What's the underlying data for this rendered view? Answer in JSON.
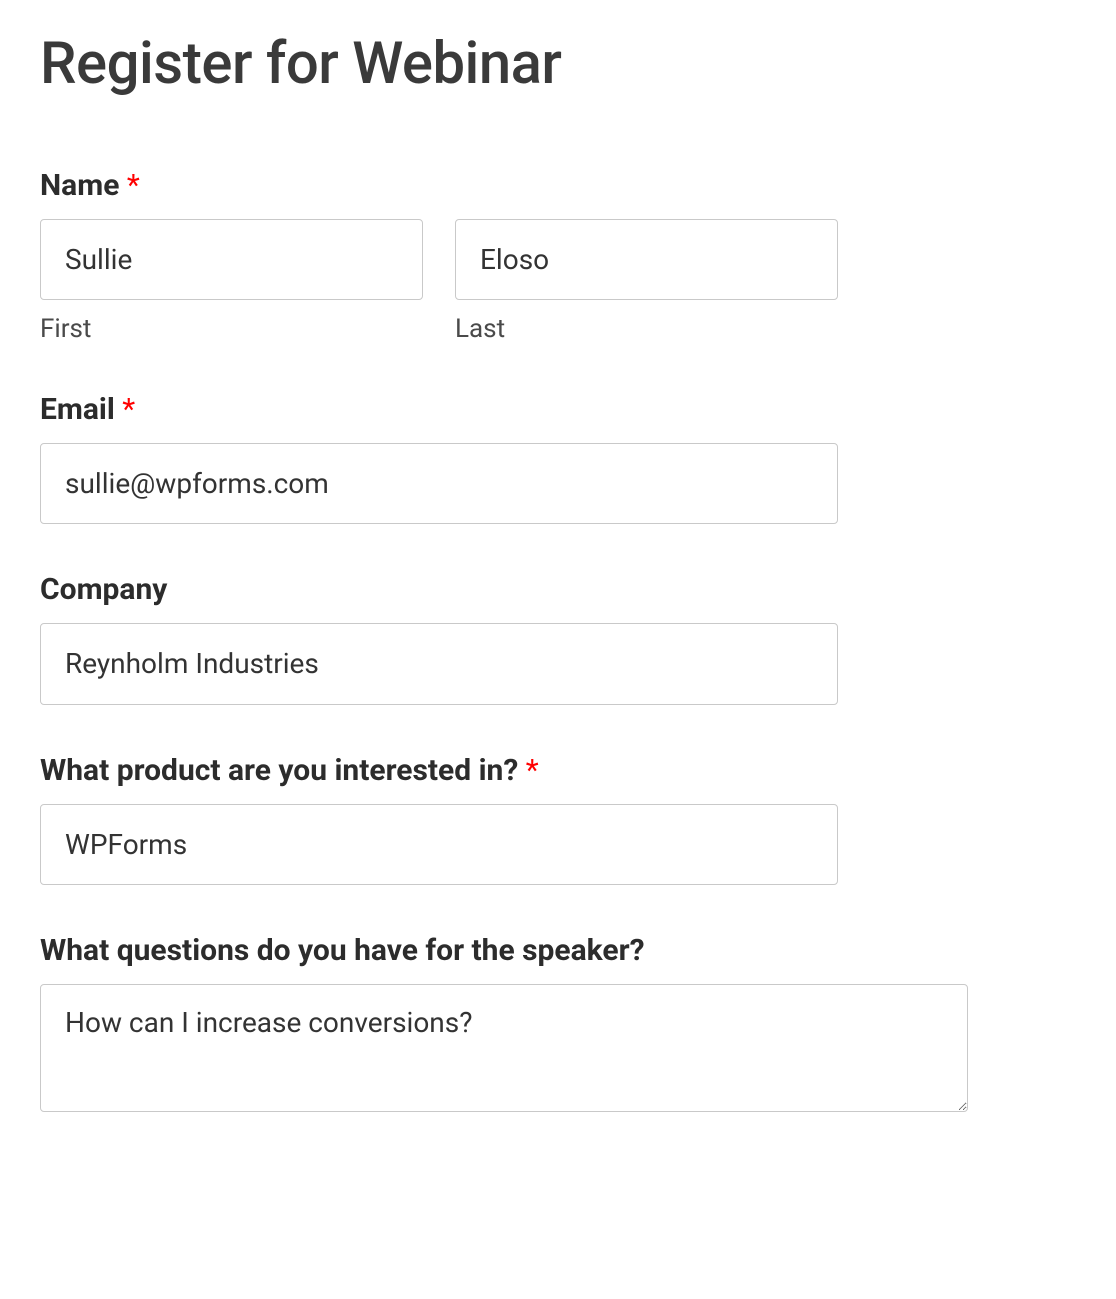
{
  "title": "Register for Webinar",
  "required_mark": "*",
  "fields": {
    "name": {
      "label": "Name ",
      "required": true,
      "first": {
        "value": "Sullie",
        "sublabel": "First"
      },
      "last": {
        "value": "Eloso",
        "sublabel": "Last"
      }
    },
    "email": {
      "label": "Email ",
      "required": true,
      "value": "sullie@wpforms.com"
    },
    "company": {
      "label": "Company",
      "required": false,
      "value": "Reynholm Industries"
    },
    "product": {
      "label": "What product are you interested in? ",
      "required": true,
      "value": "WPForms"
    },
    "questions": {
      "label": "What questions do you have for the speaker?",
      "required": false,
      "value": "How can I increase conversions?"
    }
  }
}
